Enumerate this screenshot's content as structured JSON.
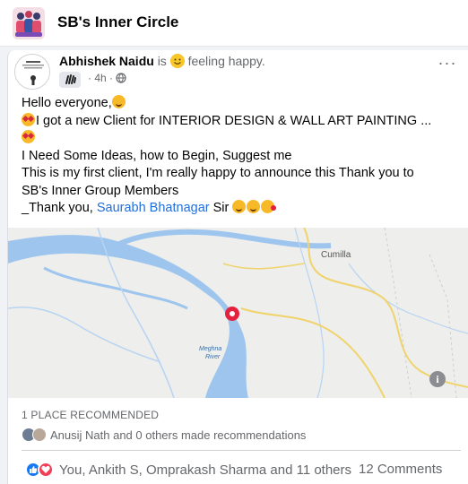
{
  "group": {
    "name": "SB's Inner Circle",
    "avatar_icon": "group-cover-icon"
  },
  "post": {
    "author": "Abhishek Naidu",
    "is_text": "is",
    "feeling_text": "feeling happy.",
    "time": "4h",
    "time_separator": "·",
    "audience_icon": "globe-icon",
    "badge_icon": "wave-badge-icon",
    "more_label": "···",
    "body": {
      "line1": "Hello everyone,",
      "line2": "I got a new Client for INTERIOR DESIGN & WALL ART PAINTING ...",
      "line4": "I Need Some Ideas, how to Begin, Suggest me",
      "line5": " This is my first client, I'm really happy to announce this Thank you to",
      "line6": "SB's Inner Group Members",
      "line7_prefix": "_Thank you, ",
      "mention": "Saurabh Bhatnagar",
      "line7_suffix": " Sir "
    },
    "map": {
      "city_label": "Cumilla",
      "river_label_1": "Meghna",
      "river_label_2": "River",
      "pin_color": "#e4223d",
      "info_label": "i"
    },
    "recommendations": {
      "count_label": "1 PLACE RECOMMENDED",
      "made_by": "Anusij Nath and 0 others made recommendations"
    },
    "reactions": {
      "names": "You, Ankith S, Omprakash Sharma and 11 others",
      "comments": "12 Comments",
      "like_color": "#1877f2",
      "love_color": "#f33e58"
    }
  }
}
